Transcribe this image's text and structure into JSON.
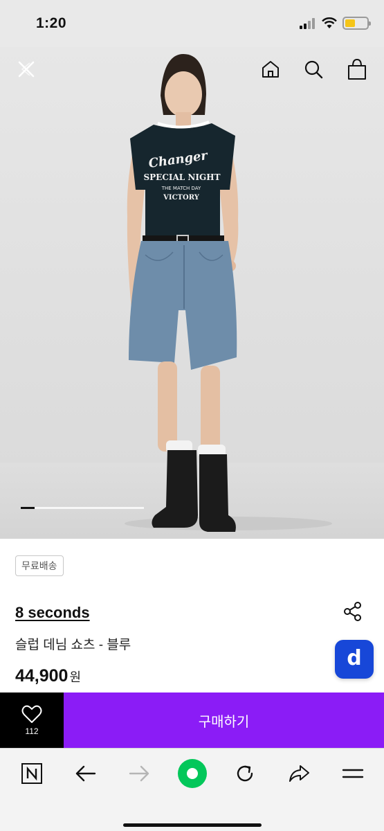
{
  "status_bar": {
    "time": "1:20",
    "battery_level": 0.45,
    "battery_color": "#f5c518"
  },
  "header": {
    "icons": [
      "close-icon",
      "home-icon",
      "search-icon",
      "shopping-bag-icon"
    ]
  },
  "hero": {
    "shirt_print": {
      "line1": "Changer",
      "line2": "SPECIAL NIGHT",
      "line3": "THE MATCH DAY",
      "line4": "VICTORY"
    },
    "carousel_progress": 0.11
  },
  "product": {
    "badge": "무료배송",
    "brand": "8 seconds",
    "name": "슬럽 데님 쇼츠 - 블루",
    "price": "44,900",
    "currency": "원",
    "app_button_letter": "d",
    "app_button_color": "#1747d8"
  },
  "purchase_bar": {
    "like_count": "112",
    "buy_label": "구매하기",
    "buy_color": "#8b1cf6"
  },
  "browser_toolbar": {
    "icons": [
      "naver-n-icon",
      "back-arrow-icon",
      "forward-arrow-icon",
      "green-dot-icon",
      "reload-icon",
      "share-arrow-icon",
      "menu-icon"
    ],
    "accent_color": "#03c75a"
  }
}
